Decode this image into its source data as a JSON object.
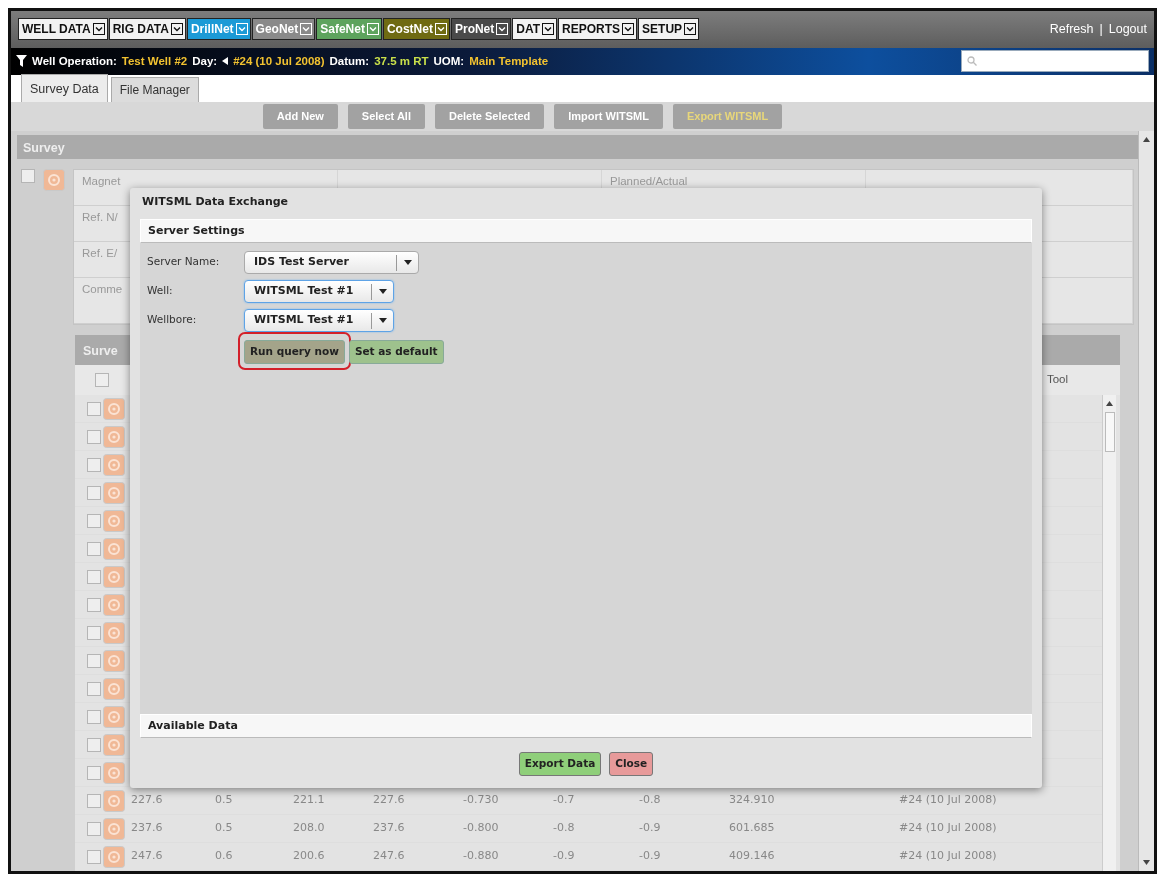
{
  "menu": [
    {
      "label": "WELL DATA",
      "color": "#f2f2f2"
    },
    {
      "label": "RIG DATA",
      "color": "#f2f2f2"
    },
    {
      "label": "DrillNet",
      "color": "#1c9ad6"
    },
    {
      "label": "GeoNet",
      "color": "#8a8a8a"
    },
    {
      "label": "SafeNet",
      "color": "#5da35d"
    },
    {
      "label": "CostNet",
      "color": "#6f6a12"
    },
    {
      "label": "ProNet",
      "color": "#4a4a4a"
    },
    {
      "label": "DAT",
      "color": "#f2f2f2"
    },
    {
      "label": "REPORTS",
      "color": "#f2f2f2"
    },
    {
      "label": "SETUP",
      "color": "#f2f2f2"
    }
  ],
  "header_links": [
    "Refresh",
    "|",
    "Logout"
  ],
  "info_bar": [
    {
      "label": "Well Operation:",
      "value": "Test Well #2",
      "kind": "text"
    },
    {
      "label": "Day:",
      "value": "#24 (10 Jul 2008)",
      "kind": "day"
    },
    {
      "label": "Datum:",
      "value": "37.5 m RT",
      "kind": "text"
    },
    {
      "label": "UOM:",
      "value": "Main Template",
      "kind": "text"
    }
  ],
  "tabs": [
    {
      "label": "Survey Data",
      "selected": true
    },
    {
      "label": "File Manager",
      "selected": false
    }
  ],
  "toolbar": [
    {
      "label": "Add New",
      "accent": false
    },
    {
      "label": "Select All",
      "accent": false
    },
    {
      "label": "Delete Selected",
      "accent": false
    },
    {
      "label": "Import WITSML",
      "accent": false
    },
    {
      "label": "Export WITSML",
      "accent": true
    }
  ],
  "survey": {
    "title": "Survey",
    "checked": false,
    "fields": [
      "Magnet",
      "Ref. N/",
      "Ref. E/",
      "Comme"
    ],
    "right_fields": [
      "Planned/Actual"
    ],
    "table": {
      "title": "Surve",
      "header_checked": false,
      "tool_column": "Tool",
      "rows": [
        {
          "checked": false
        },
        {
          "checked": false
        },
        {
          "checked": false
        },
        {
          "checked": false
        },
        {
          "checked": false
        },
        {
          "checked": false
        },
        {
          "checked": false
        },
        {
          "checked": false
        },
        {
          "checked": false
        },
        {
          "checked": false
        },
        {
          "checked": false
        },
        {
          "checked": false
        },
        {
          "checked": false
        },
        {
          "checked": false
        },
        {
          "checked": false,
          "cells": [
            "227.6",
            "0.5",
            "221.1",
            "227.6",
            "-0.730",
            "-0.7",
            "-0.8",
            "324.910",
            "",
            "#24 (10 Jul 2008)"
          ]
        },
        {
          "checked": false,
          "cells": [
            "237.6",
            "0.5",
            "208.0",
            "237.6",
            "-0.800",
            "-0.8",
            "-0.9",
            "601.685",
            "",
            "#24 (10 Jul 2008)"
          ]
        },
        {
          "checked": false,
          "cells": [
            "247.6",
            "0.6",
            "200.6",
            "247.6",
            "-0.880",
            "-0.9",
            "-0.9",
            "409.146",
            "",
            "#24 (10 Jul 2008)"
          ]
        }
      ]
    }
  },
  "dialog": {
    "title": "WITSML Data Exchange",
    "sections": [
      "Server Settings",
      "Available Data"
    ],
    "fields": [
      {
        "label": "Server Name:",
        "value": "IDS Test Server",
        "focused": false
      },
      {
        "label": "Well:",
        "value": "WITSML Test #1",
        "focused": true
      },
      {
        "label": "Wellbore:",
        "value": "WITSML Test #1",
        "focused": true
      }
    ],
    "actions": [
      {
        "label": "Run query now",
        "circled": true
      },
      {
        "label": "Set as default",
        "circled": false
      }
    ],
    "footer_buttons": [
      {
        "label": "Export Data",
        "kind": "primary"
      },
      {
        "label": "Close",
        "kind": "danger"
      }
    ]
  }
}
